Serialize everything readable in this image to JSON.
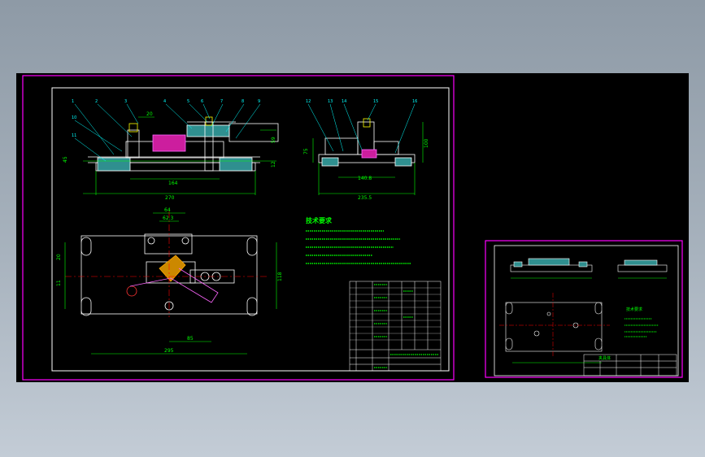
{
  "main_sheet": {
    "tech_title": "技术要求",
    "dims": {
      "d_20": "20",
      "d_164": "164",
      "d_270": "270",
      "d_45": "45",
      "d_59": "59",
      "d_12": "12",
      "d_75": "75",
      "d_100": "100",
      "d_1408": "140.8",
      "d_2355": "235.5",
      "d_64": "64",
      "d_623": "62.3",
      "d_85": "85",
      "d_295": "295",
      "d_20b": "20",
      "d_11": "11",
      "d_118": "118"
    },
    "callouts": [
      "1",
      "2",
      "3",
      "4",
      "5",
      "6",
      "7",
      "8",
      "9",
      "10",
      "11",
      "12",
      "13",
      "14",
      "15",
      "16",
      "17",
      "18"
    ]
  },
  "detail_sheet": {
    "tech_title": "技术要求",
    "title_cell": "夹具体"
  },
  "colors": {
    "frame": "#ff00ff",
    "outline": "#ffffff",
    "dimension": "#00ff00",
    "centerline": "#ff0000",
    "leader": "#00ffff",
    "hatch": "#ff00ff",
    "background": "#000000"
  }
}
